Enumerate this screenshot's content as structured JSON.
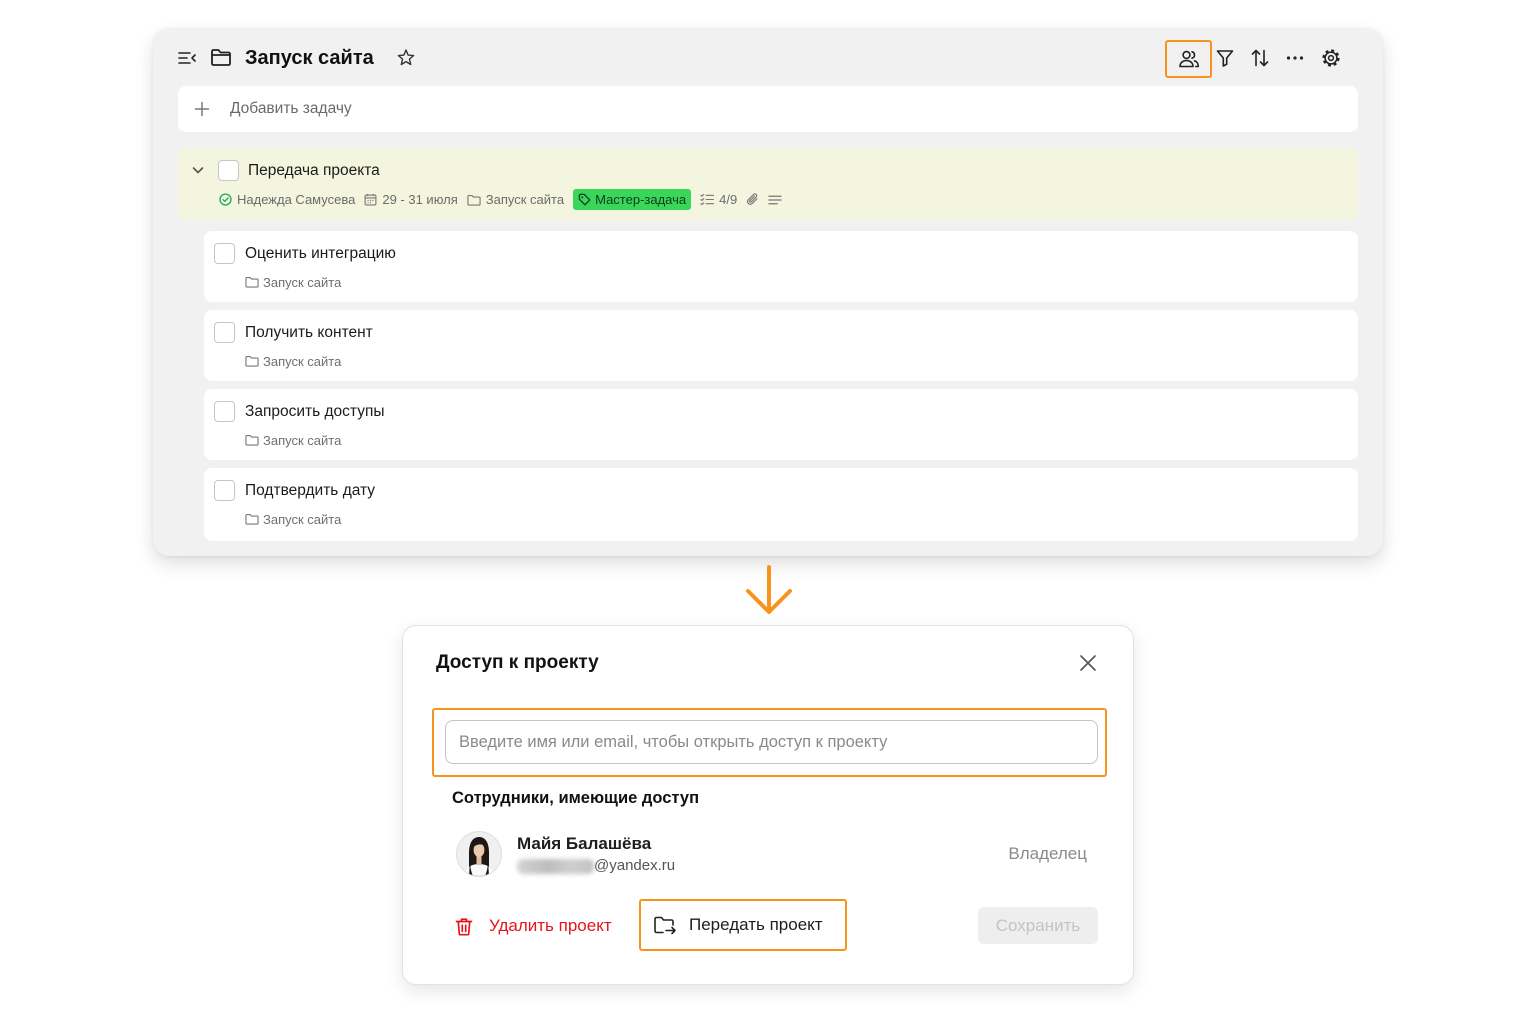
{
  "colors": {
    "accent": "#f7941d",
    "tag_green": "#3ad65a",
    "master_bg": "#f3f5de",
    "danger": "#e5151d",
    "card_bg": "#f1f1f1",
    "ok_green": "#27ae60"
  },
  "icons": {
    "header": [
      "sidebar-toggle-icon",
      "folder-icon",
      "star-icon",
      "users-icon",
      "filter-icon",
      "sort-icon",
      "more-icon",
      "gear-icon"
    ],
    "task_meta": [
      "check-circle-icon",
      "calendar-icon",
      "folder-icon",
      "tag-icon",
      "checklist-icon",
      "paperclip-icon",
      "description-icon"
    ],
    "dialog": [
      "close-icon",
      "trash-icon",
      "folder-transfer-icon"
    ]
  },
  "project": {
    "title": "Запуск сайта"
  },
  "add_task": {
    "label": "Добавить задачу"
  },
  "master_task": {
    "title": "Передача проекта",
    "assignee": "Надежда Самусева",
    "dates": "29 - 31 июля",
    "project": "Запуск сайта",
    "tag": "Мастер-задача",
    "checklist": "4/9"
  },
  "subtasks": [
    {
      "title": "Оценить интеграцию",
      "project": "Запуск сайта"
    },
    {
      "title": "Получить контент",
      "project": "Запуск сайта"
    },
    {
      "title": "Запросить доступы",
      "project": "Запуск сайта"
    },
    {
      "title": "Подтвердить дату",
      "project": "Запуск сайта"
    }
  ],
  "dialog": {
    "title": "Доступ к проекту",
    "search_placeholder": "Введите имя или email, чтобы открыть доступ к проекту",
    "members_heading": "Сотрудники, имеющие доступ",
    "members": [
      {
        "name": "Майя Балашёва",
        "email_domain": "@yandex.ru",
        "role": "Владелец"
      }
    ],
    "delete_label": "Удалить проект",
    "transfer_label": "Передать проект",
    "save_label": "Сохранить"
  }
}
